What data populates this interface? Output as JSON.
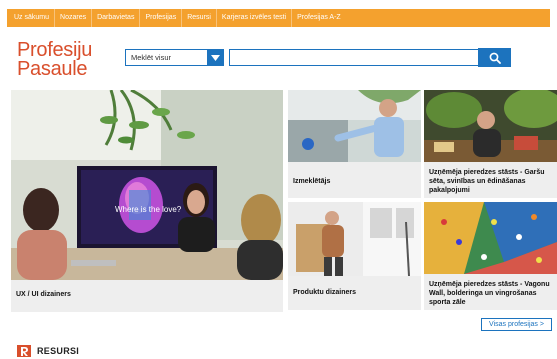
{
  "nav": {
    "items": [
      "Uz sākumu",
      "Nozares",
      "Darbavietas",
      "Profesijas",
      "Resursi",
      "Karjeras izvēles testi",
      "Profesijas A-Z"
    ]
  },
  "logo": {
    "line1": "Profesiju",
    "line2": "Pasaule"
  },
  "search": {
    "select_value": "Meklēt visur",
    "input_value": "",
    "button_icon": "search-icon"
  },
  "tiles": [
    {
      "caption": "UX / UI dizainers",
      "screen_text": "Where is the love?"
    },
    {
      "caption": "Izmeklētājs"
    },
    {
      "caption": "Uzņēmēja pieredzes stāsts - Garšu sēta, svinības un ēdināšanas pakalpojumi"
    },
    {
      "caption": "Produktu dizainers"
    },
    {
      "caption": "Uzņēmēja pieredzes stāsts - Vagonu Wall, bolderinga un vingrošanas sporta zāle"
    }
  ],
  "all_professions_link": "Visas profesijas >",
  "resources": {
    "title": "RESURSI",
    "icon": "resources-icon"
  },
  "colors": {
    "nav": "#f4a12e",
    "accent": "#1c73be",
    "brand": "#d94f2c"
  }
}
